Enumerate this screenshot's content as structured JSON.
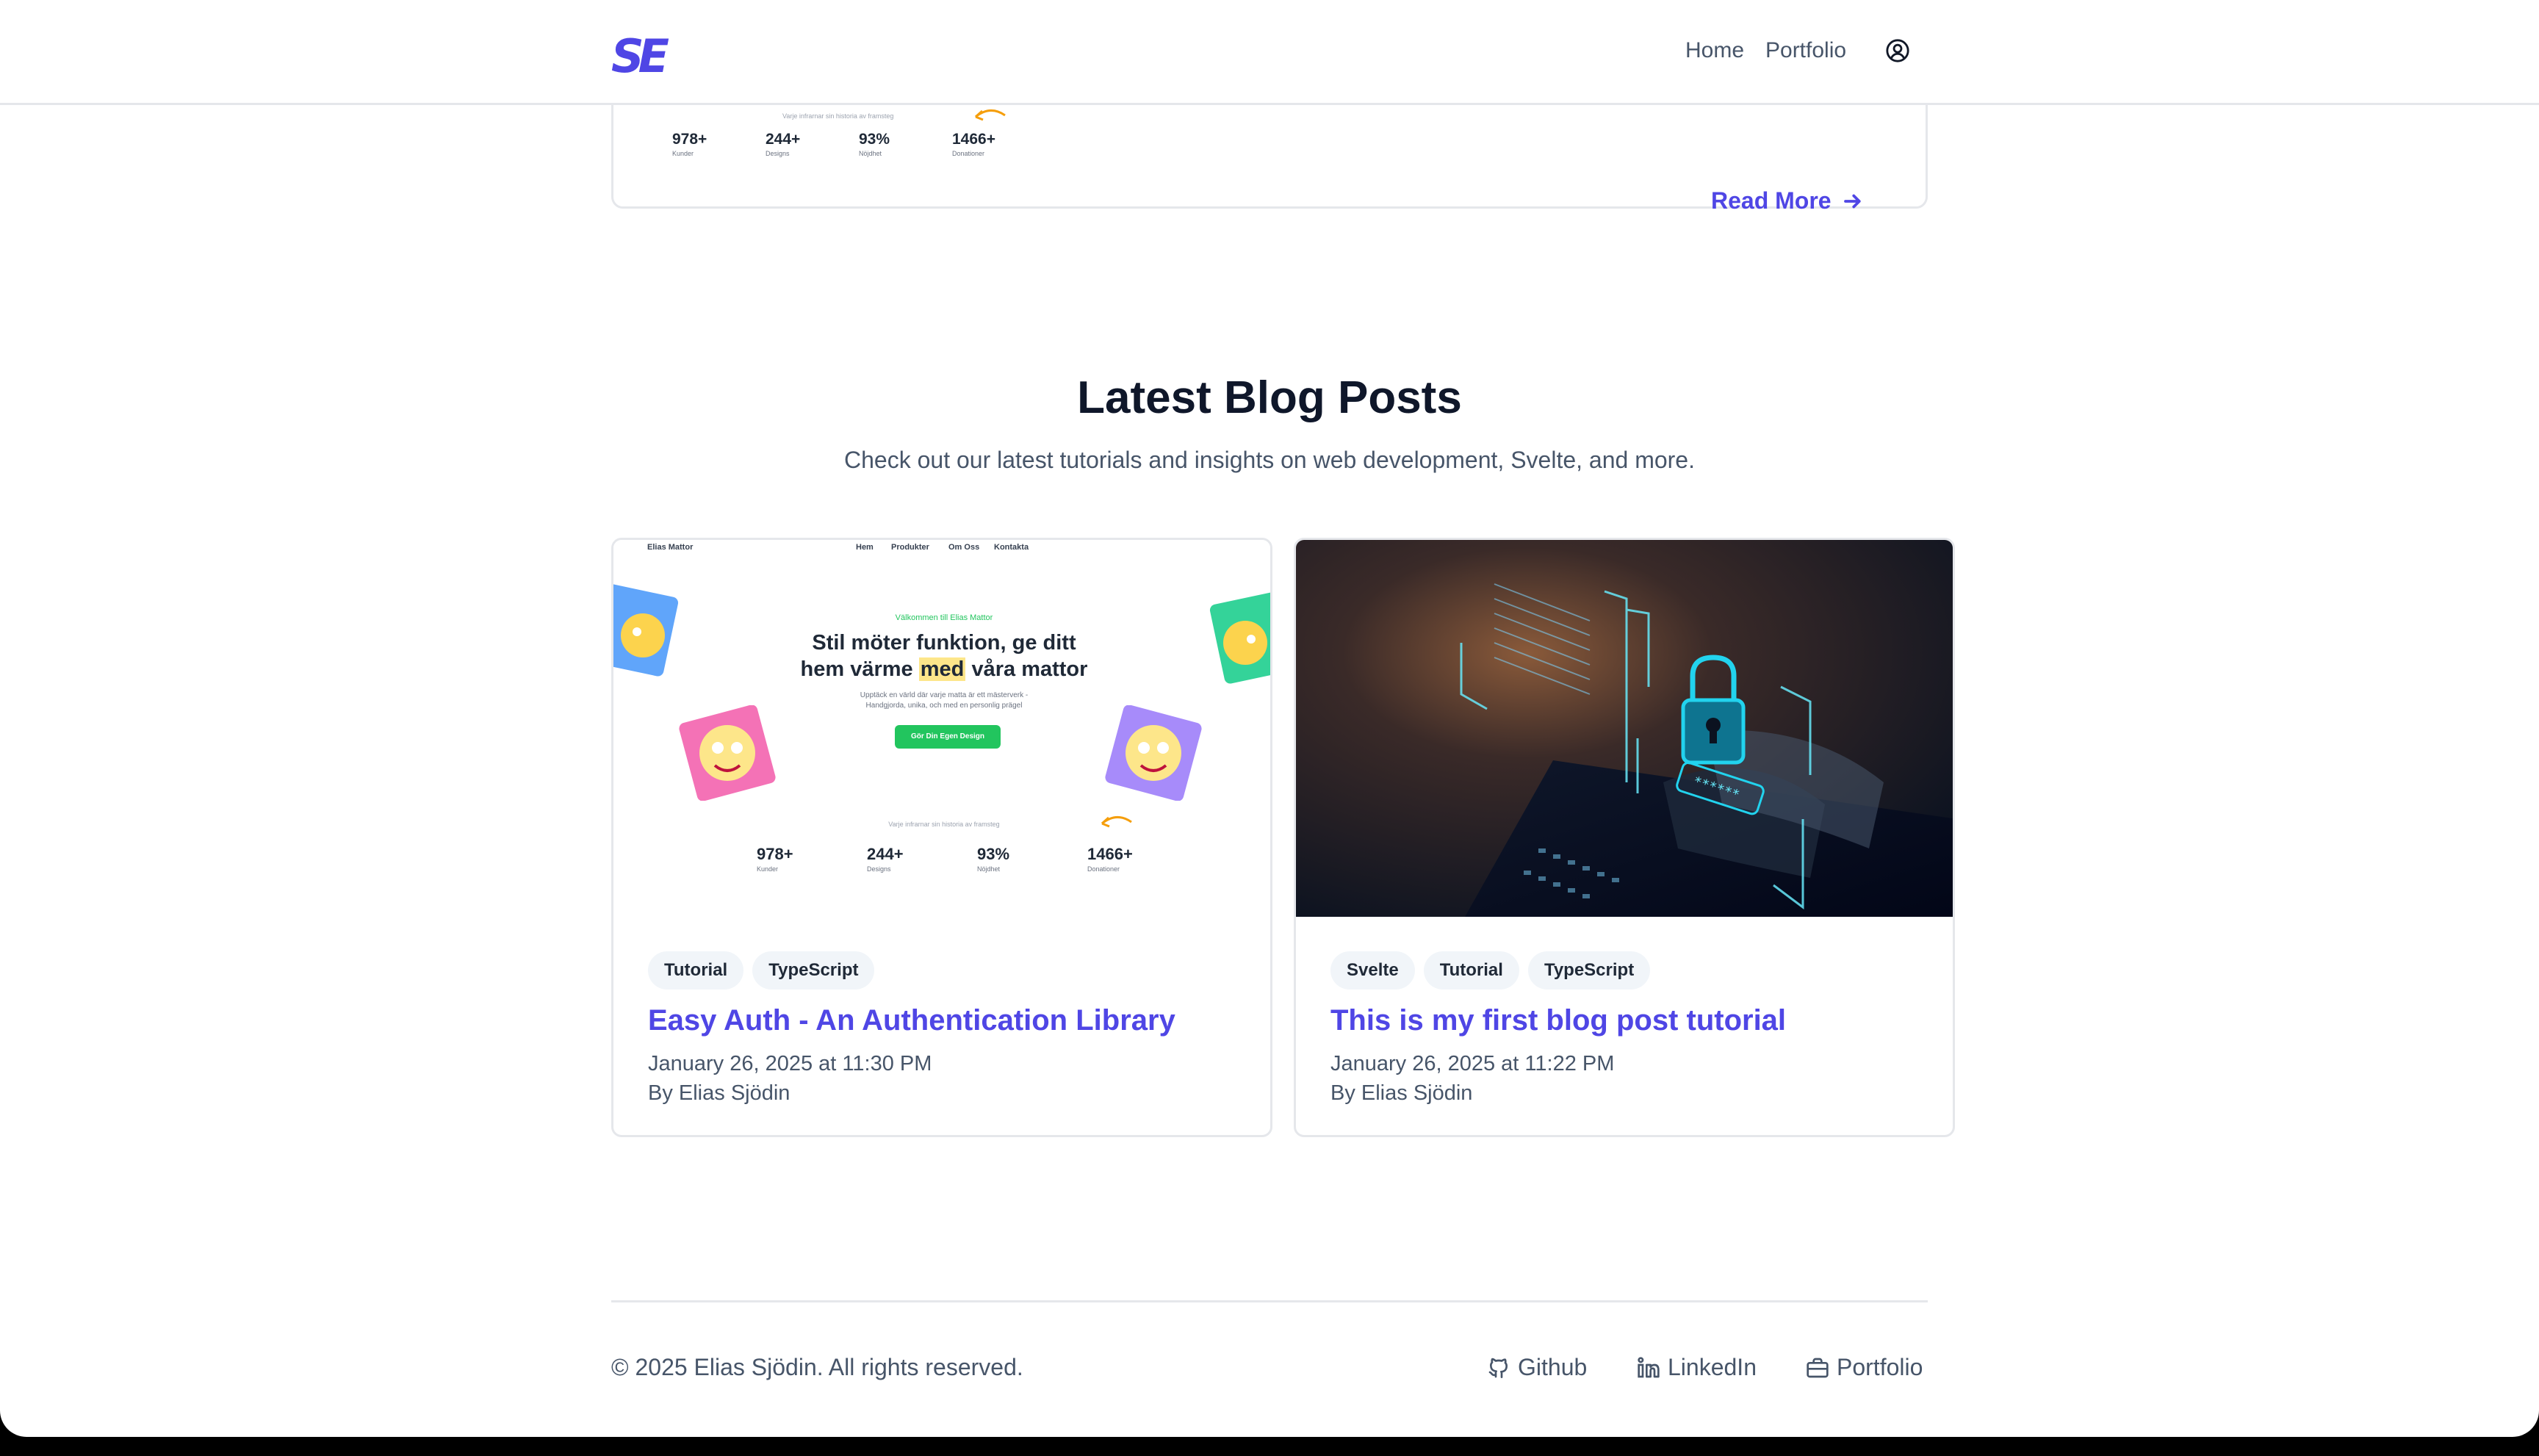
{
  "header": {
    "logo": "SE",
    "nav": {
      "home": "Home",
      "portfolio": "Portfolio"
    }
  },
  "prev_card": {
    "tiny_text": "Varje infrarnar sin historia av framsteg",
    "stats": [
      {
        "value": "978+",
        "label": "Kunder"
      },
      {
        "value": "244+",
        "label": "Designs"
      },
      {
        "value": "93%",
        "label": "Nöjdhet"
      },
      {
        "value": "1466+",
        "label": "Donationer"
      }
    ],
    "read_more": "Read More"
  },
  "section": {
    "title": "Latest Blog Posts",
    "subtitle": "Check out our latest tutorials and insights on web development, Svelte, and more."
  },
  "posts": [
    {
      "tags": [
        "Tutorial",
        "TypeScript"
      ],
      "title": "Easy Auth - An Authentication Library",
      "date": "January 26, 2025 at 11:30 PM",
      "author": "By Elias Sjödin",
      "mock": {
        "brand": "Elias Mattor",
        "nav": [
          "Hem",
          "Produkter",
          "Om Oss",
          "Kontakta"
        ],
        "welcome": "Välkommen till Elias Mattor",
        "headline_1": "Stil möter funktion, ge ditt",
        "headline_2a": "hem värme",
        "headline_hl": "med",
        "headline_2b": "våra mattor",
        "body_1": "Upptäck en värld där varje matta är ett mästerverk -",
        "body_2": "Handgjorda, unika, och med en personlig prägel",
        "cta": "Gör Din Egen Design",
        "small": "Varje infrarnar sin historia av framsteg",
        "stats": [
          {
            "value": "978+",
            "label": "Kunder"
          },
          {
            "value": "244+",
            "label": "Designs"
          },
          {
            "value": "93%",
            "label": "Nöjdhet"
          },
          {
            "value": "1466+",
            "label": "Donationer"
          }
        ]
      }
    },
    {
      "tags": [
        "Svelte",
        "Tutorial",
        "TypeScript"
      ],
      "title": "This is my first blog post tutorial",
      "date": "January 26, 2025 at 11:22 PM",
      "author": "By Elias Sjödin",
      "image_text": "******"
    }
  ],
  "footer": {
    "copyright": "© 2025 Elias Sjödin. All rights reserved.",
    "links": [
      "Github",
      "LinkedIn",
      "Portfolio"
    ]
  }
}
